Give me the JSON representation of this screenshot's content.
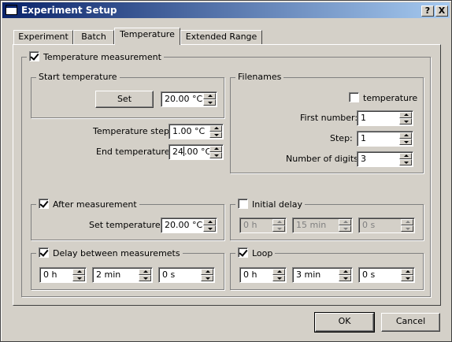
{
  "window": {
    "title": "Experiment Setup",
    "help_btn": "?",
    "close_btn": "X"
  },
  "tabs": [
    {
      "label": "Experiment"
    },
    {
      "label": "Batch"
    },
    {
      "label": "Temperature"
    },
    {
      "label": "Extended Range"
    }
  ],
  "temperature_measurement": {
    "label": "Temperature measurement",
    "checked": true,
    "start_temperature": {
      "title": "Start temperature",
      "set_button": "Set",
      "value": "20.00 °C"
    },
    "temperature_step": {
      "label": "Temperature step:",
      "value": "1.00 °C"
    },
    "end_temperature": {
      "label": "End temperature:",
      "value_before_caret": "24",
      "value_after_caret": ".00 °C"
    },
    "filenames": {
      "title": "Filenames",
      "temperature_checkbox": {
        "label": "temperature",
        "checked": false
      },
      "first_number": {
        "label": "First number:",
        "value": "1"
      },
      "step": {
        "label": "Step:",
        "value": "1"
      },
      "number_of_digits": {
        "label": "Number of digits:",
        "value": "3"
      }
    },
    "after_measurement": {
      "label": "After measurement",
      "checked": true,
      "set_temperature": {
        "label": "Set temperature:",
        "value": "20.00 °C"
      }
    },
    "initial_delay": {
      "label": "Initial delay",
      "checked": false,
      "hours": "0 h",
      "minutes": "15 min",
      "seconds": "0 s"
    },
    "delay_between": {
      "label": "Delay between measuremets",
      "checked": true,
      "hours": "0 h",
      "minutes": "2 min",
      "seconds": "0 s"
    },
    "loop": {
      "label": "Loop",
      "checked": true,
      "hours": "0 h",
      "minutes": "3 min",
      "seconds": "0 s"
    }
  },
  "buttons": {
    "ok": "OK",
    "cancel": "Cancel"
  }
}
